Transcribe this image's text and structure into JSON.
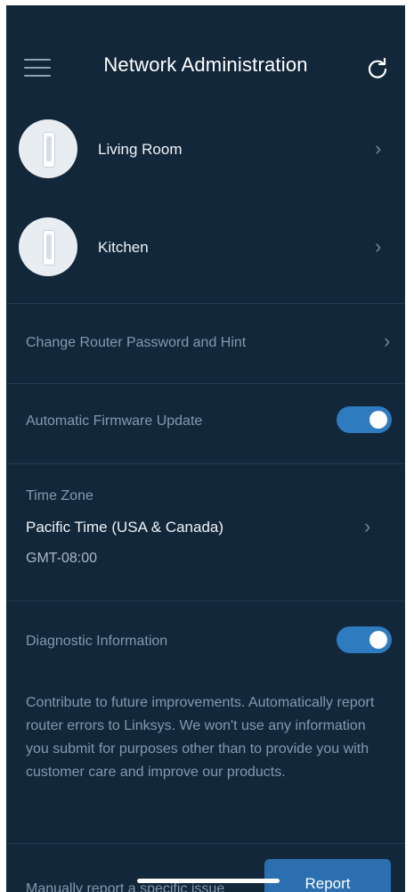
{
  "header": {
    "title": "Network Administration",
    "menu_icon": "hamburger-menu-icon",
    "refresh_icon": "refresh-icon"
  },
  "nodes": [
    {
      "label": "Living Room",
      "icon": "router-node-icon"
    },
    {
      "label": "Kitchen",
      "icon": "router-node-icon"
    }
  ],
  "settings": {
    "router_password": "Change Router Password and Hint",
    "firmware": {
      "label": "Automatic Firmware Update",
      "enabled": true
    },
    "time_zone": {
      "label": "Time Zone",
      "value": "Pacific Time (USA & Canada)",
      "offset": "GMT-08:00"
    },
    "diagnostics": {
      "label": "Diagnostic Information",
      "enabled": true,
      "description": "Contribute to future improvements. Automatically report router errors to Linksys. We won't use any information you submit for purposes other than to provide you with customer care and improve our products."
    },
    "manual_report": {
      "label": "Manually report a specific issue",
      "button": "Report"
    }
  },
  "colors": {
    "background": "#13273a",
    "toggle_on": "#2f7bbf",
    "button": "#2b6fb0"
  }
}
